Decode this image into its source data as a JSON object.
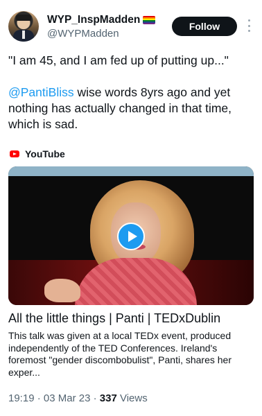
{
  "author": {
    "display_name": "WYP_InspMadden",
    "flag_icon": "rainbow-flag-icon",
    "handle": "@WYPMadden"
  },
  "follow_button": {
    "label": "Follow"
  },
  "tweet": {
    "quote": "\"I am 45, and I am fed up of putting up...\"",
    "mention": "@PantiBliss",
    "text_after_mention": " wise words 8yrs ago and yet nothing has actually changed in that time, which is sad."
  },
  "link_card": {
    "source_icon": "youtube-icon",
    "source_label": "YouTube",
    "title": "All the little things | Panti | TEDxDublin",
    "description": "This talk was given at a local TEDx event, produced independently of the TED Conferences. Ireland's foremost \"gender discombobulist\", Panti, shares her exper..."
  },
  "meta": {
    "time": "19:19",
    "separator1": " · ",
    "date": "03 Mar 23",
    "separator2": " · ",
    "views_count": "337",
    "views_label": " Views"
  },
  "colors": {
    "accent": "#1d9bf0",
    "text": "#0f1419",
    "muted": "#536471",
    "follow_bg": "#0f1419"
  }
}
